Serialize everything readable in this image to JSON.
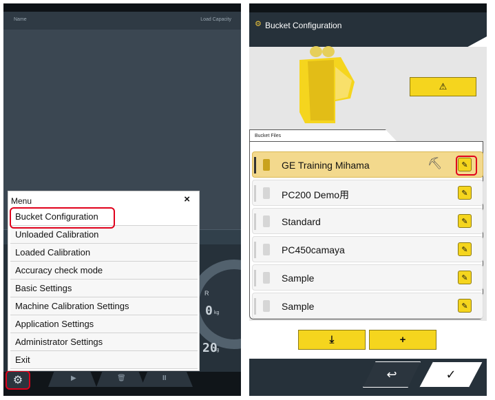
{
  "left": {
    "header": {
      "name_label": "Name",
      "capacity_label": "Load Capacity"
    },
    "gauge": {
      "r_label": "R",
      "value_top": "0",
      "unit_top": "kg",
      "value_bottom": "20",
      "unit_bottom": "kg"
    },
    "menu": {
      "title": "Menu",
      "close": "×",
      "items": [
        "Bucket Configuration",
        "Unloaded Calibration",
        "Loaded Calibration",
        "Accuracy check mode",
        "Basic Settings",
        "Machine Calibration Settings",
        "Application Settings",
        "Administrator Settings",
        "Exit"
      ],
      "highlighted_item": "Bucket Configuration"
    },
    "bottom": {
      "play": "▶",
      "trash": "🗑",
      "pause": "II",
      "settings": "⚙"
    }
  },
  "right": {
    "header": {
      "icon": "gear-icon",
      "title": "Bucket Configuration"
    },
    "bucket_button": "⚠",
    "files_label": "Bucket Files",
    "files": [
      {
        "name": "GE Training Mihama",
        "selected": true,
        "edit": "✎"
      },
      {
        "name": "PC200 Demo用",
        "selected": false,
        "edit": "✎"
      },
      {
        "name": "Standard",
        "selected": false,
        "edit": "✎"
      },
      {
        "name": "PC450camaya",
        "selected": false,
        "edit": "✎"
      },
      {
        "name": "Sample",
        "selected": false,
        "edit": "✎"
      },
      {
        "name": "Sample",
        "selected": false,
        "edit": "✎"
      }
    ],
    "import_button": "⤓",
    "add_button": "+",
    "back_button": "↩",
    "ok_button": "✓"
  },
  "colors": {
    "accent_yellow": "#f5d51e",
    "highlight_red": "#e0001b",
    "dark_bg": "#26313a"
  }
}
